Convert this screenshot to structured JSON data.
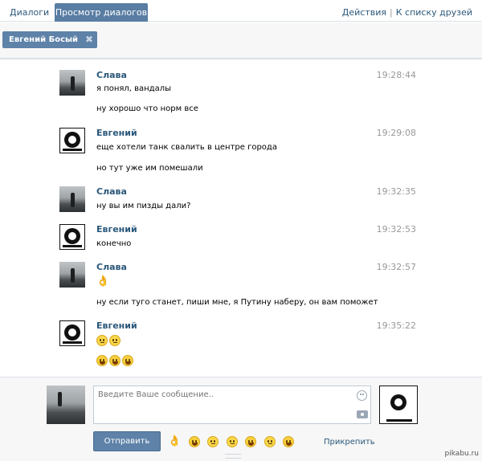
{
  "tabs": {
    "dialogs": "Диалоги",
    "view_dialogs": "Просмотр диалогов"
  },
  "toplinks": {
    "actions": "Действия",
    "separator": "|",
    "friends": "К списку друзей"
  },
  "filter": {
    "chip_label": "Евгений Босый",
    "chip_close": "✖"
  },
  "messages": [
    {
      "author": "Слава",
      "time": "19:28:44",
      "lines": [
        "я понял, вандалы",
        "ну хорошо что норм все"
      ]
    },
    {
      "author": "Евгений",
      "time": "19:29:08",
      "lines": [
        "еще хотели танк свалить в центре города",
        "но тут уже им помешали"
      ]
    },
    {
      "author": "Слава",
      "time": "19:32:35",
      "lines": [
        "ну вы им пизды дали?"
      ]
    },
    {
      "author": "Евгений",
      "time": "19:32:53",
      "lines": [
        "конечно"
      ]
    },
    {
      "author": "Слава",
      "time": "19:32:57",
      "lines": [
        "ну если туго станет, пиши мне, я Путину наберу, он вам поможет"
      ]
    },
    {
      "author": "Евгений",
      "time": "19:35:22",
      "lines": []
    }
  ],
  "icons": {
    "ok_hand": "👌"
  },
  "composer": {
    "placeholder": "Введите Ваше сообщение..",
    "send_label": "Отправить",
    "attach_label": "Прикрепить"
  },
  "watermark": "pikabu.ru",
  "colors": {
    "accent": "#597da3",
    "link": "#2b587a",
    "time": "#999999"
  }
}
